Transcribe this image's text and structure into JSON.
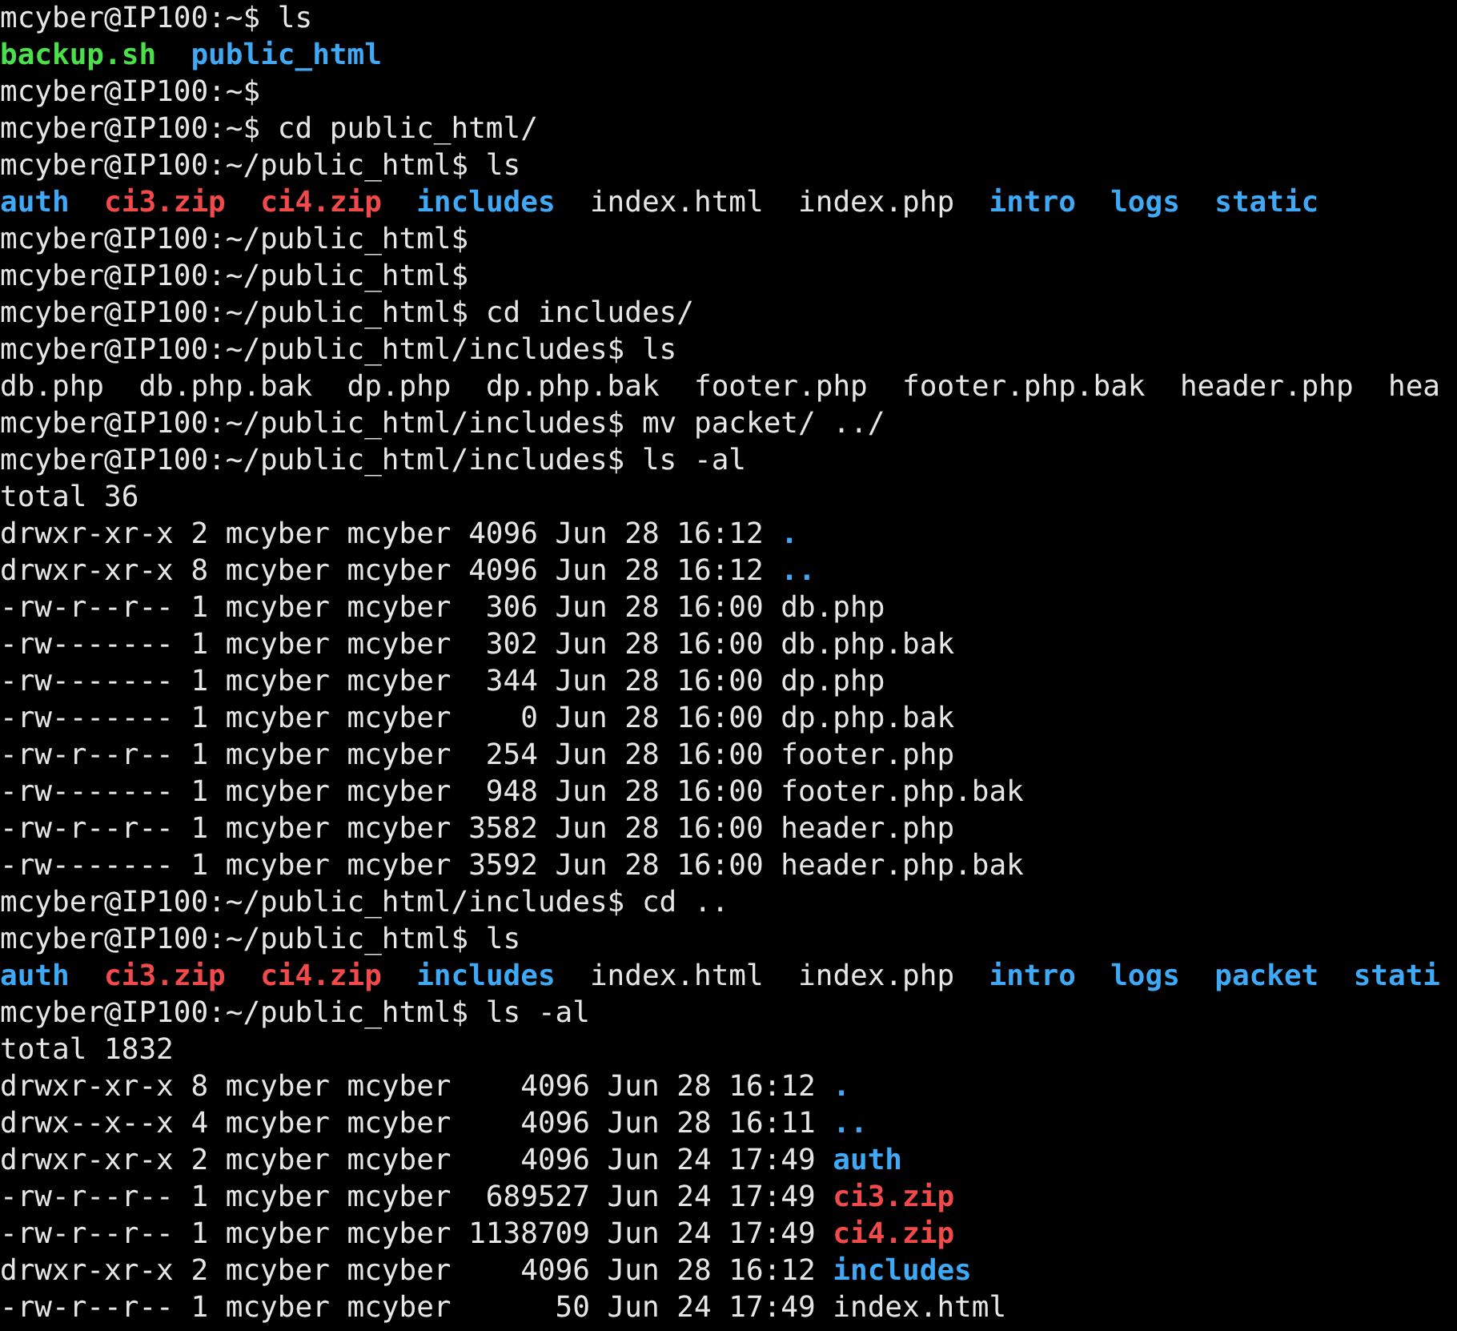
{
  "terminal": {
    "lines": [
      {
        "kind": "text",
        "segments": [
          {
            "text": "mcyber@IP100:~$ ls",
            "kind": "plain"
          }
        ]
      },
      {
        "kind": "listing",
        "segments": [
          {
            "text": "backup.sh",
            "kind": "exec"
          },
          {
            "text": "public_html",
            "kind": "dir"
          }
        ]
      },
      {
        "kind": "text",
        "segments": [
          {
            "text": "mcyber@IP100:~$",
            "kind": "plain"
          }
        ]
      },
      {
        "kind": "text",
        "segments": [
          {
            "text": "mcyber@IP100:~$ cd public_html/",
            "kind": "plain"
          }
        ]
      },
      {
        "kind": "text",
        "segments": [
          {
            "text": "mcyber@IP100:~/public_html$ ls",
            "kind": "plain"
          }
        ]
      },
      {
        "kind": "listing",
        "segments": [
          {
            "text": "auth",
            "kind": "dir"
          },
          {
            "text": "ci3.zip",
            "kind": "archive"
          },
          {
            "text": "ci4.zip",
            "kind": "archive"
          },
          {
            "text": "includes",
            "kind": "dir"
          },
          {
            "text": "index.html",
            "kind": "plain"
          },
          {
            "text": "index.php",
            "kind": "plain"
          },
          {
            "text": "intro",
            "kind": "dir"
          },
          {
            "text": "logs",
            "kind": "dir"
          },
          {
            "text": "static",
            "kind": "dir"
          }
        ]
      },
      {
        "kind": "text",
        "segments": [
          {
            "text": "mcyber@IP100:~/public_html$",
            "kind": "plain"
          }
        ]
      },
      {
        "kind": "text",
        "segments": [
          {
            "text": "mcyber@IP100:~/public_html$",
            "kind": "plain"
          }
        ]
      },
      {
        "kind": "text",
        "segments": [
          {
            "text": "mcyber@IP100:~/public_html$ cd includes/",
            "kind": "plain"
          }
        ]
      },
      {
        "kind": "text",
        "segments": [
          {
            "text": "mcyber@IP100:~/public_html/includes$ ls",
            "kind": "plain"
          }
        ]
      },
      {
        "kind": "listing",
        "segments": [
          {
            "text": "db.php",
            "kind": "plain"
          },
          {
            "text": "db.php.bak",
            "kind": "plain"
          },
          {
            "text": "dp.php",
            "kind": "plain"
          },
          {
            "text": "dp.php.bak",
            "kind": "plain"
          },
          {
            "text": "footer.php",
            "kind": "plain"
          },
          {
            "text": "footer.php.bak",
            "kind": "plain"
          },
          {
            "text": "header.php",
            "kind": "plain"
          },
          {
            "text": "hea",
            "kind": "plain"
          }
        ]
      },
      {
        "kind": "text",
        "segments": [
          {
            "text": "mcyber@IP100:~/public_html/includes$ mv packet/ ../",
            "kind": "plain"
          }
        ]
      },
      {
        "kind": "text",
        "segments": [
          {
            "text": "mcyber@IP100:~/public_html/includes$ ls -al",
            "kind": "plain"
          }
        ]
      },
      {
        "kind": "text",
        "segments": [
          {
            "text": "total 36",
            "kind": "plain"
          }
        ]
      },
      {
        "kind": "detail",
        "segments": [
          {
            "text": "drwxr-xr-x 2 mcyber mcyber 4096 Jun 28 16:12",
            "kind": "plain"
          },
          {
            "text": ".",
            "kind": "dir"
          }
        ]
      },
      {
        "kind": "detail",
        "segments": [
          {
            "text": "drwxr-xr-x 8 mcyber mcyber 4096 Jun 28 16:12",
            "kind": "plain"
          },
          {
            "text": "..",
            "kind": "dir"
          }
        ]
      },
      {
        "kind": "detail",
        "segments": [
          {
            "text": "-rw-r--r-- 1 mcyber mcyber  306 Jun 28 16:00",
            "kind": "plain"
          },
          {
            "text": "db.php",
            "kind": "plain"
          }
        ]
      },
      {
        "kind": "detail",
        "segments": [
          {
            "text": "-rw------- 1 mcyber mcyber  302 Jun 28 16:00",
            "kind": "plain"
          },
          {
            "text": "db.php.bak",
            "kind": "plain"
          }
        ]
      },
      {
        "kind": "detail",
        "segments": [
          {
            "text": "-rw------- 1 mcyber mcyber  344 Jun 28 16:00",
            "kind": "plain"
          },
          {
            "text": "dp.php",
            "kind": "plain"
          }
        ]
      },
      {
        "kind": "detail",
        "segments": [
          {
            "text": "-rw------- 1 mcyber mcyber    0 Jun 28 16:00",
            "kind": "plain"
          },
          {
            "text": "dp.php.bak",
            "kind": "plain"
          }
        ]
      },
      {
        "kind": "detail",
        "segments": [
          {
            "text": "-rw-r--r-- 1 mcyber mcyber  254 Jun 28 16:00",
            "kind": "plain"
          },
          {
            "text": "footer.php",
            "kind": "plain"
          }
        ]
      },
      {
        "kind": "detail",
        "segments": [
          {
            "text": "-rw------- 1 mcyber mcyber  948 Jun 28 16:00",
            "kind": "plain"
          },
          {
            "text": "footer.php.bak",
            "kind": "plain"
          }
        ]
      },
      {
        "kind": "detail",
        "segments": [
          {
            "text": "-rw-r--r-- 1 mcyber mcyber 3582 Jun 28 16:00",
            "kind": "plain"
          },
          {
            "text": "header.php",
            "kind": "plain"
          }
        ]
      },
      {
        "kind": "detail",
        "segments": [
          {
            "text": "-rw------- 1 mcyber mcyber 3592 Jun 28 16:00",
            "kind": "plain"
          },
          {
            "text": "header.php.bak",
            "kind": "plain"
          }
        ]
      },
      {
        "kind": "text",
        "segments": [
          {
            "text": "mcyber@IP100:~/public_html/includes$ cd ..",
            "kind": "plain"
          }
        ]
      },
      {
        "kind": "text",
        "segments": [
          {
            "text": "mcyber@IP100:~/public_html$ ls",
            "kind": "plain"
          }
        ]
      },
      {
        "kind": "listing",
        "segments": [
          {
            "text": "auth",
            "kind": "dir"
          },
          {
            "text": "ci3.zip",
            "kind": "archive"
          },
          {
            "text": "ci4.zip",
            "kind": "archive"
          },
          {
            "text": "includes",
            "kind": "dir"
          },
          {
            "text": "index.html",
            "kind": "plain"
          },
          {
            "text": "index.php",
            "kind": "plain"
          },
          {
            "text": "intro",
            "kind": "dir"
          },
          {
            "text": "logs",
            "kind": "dir"
          },
          {
            "text": "packet",
            "kind": "dir"
          },
          {
            "text": "stati",
            "kind": "dir"
          }
        ]
      },
      {
        "kind": "text",
        "segments": [
          {
            "text": "mcyber@IP100:~/public_html$ ls -al",
            "kind": "plain"
          }
        ]
      },
      {
        "kind": "text",
        "segments": [
          {
            "text": "total 1832",
            "kind": "plain"
          }
        ]
      },
      {
        "kind": "detail",
        "segments": [
          {
            "text": "drwxr-xr-x 8 mcyber mcyber    4096 Jun 28 16:12",
            "kind": "plain"
          },
          {
            "text": ".",
            "kind": "dir"
          }
        ]
      },
      {
        "kind": "detail",
        "segments": [
          {
            "text": "drwx--x--x 4 mcyber mcyber    4096 Jun 28 16:11",
            "kind": "plain"
          },
          {
            "text": "..",
            "kind": "dir"
          }
        ]
      },
      {
        "kind": "detail",
        "segments": [
          {
            "text": "drwxr-xr-x 2 mcyber mcyber    4096 Jun 24 17:49",
            "kind": "plain"
          },
          {
            "text": "auth",
            "kind": "dir"
          }
        ]
      },
      {
        "kind": "detail",
        "segments": [
          {
            "text": "-rw-r--r-- 1 mcyber mcyber  689527 Jun 24 17:49",
            "kind": "plain"
          },
          {
            "text": "ci3.zip",
            "kind": "archive"
          }
        ]
      },
      {
        "kind": "detail",
        "segments": [
          {
            "text": "-rw-r--r-- 1 mcyber mcyber 1138709 Jun 24 17:49",
            "kind": "plain"
          },
          {
            "text": "ci4.zip",
            "kind": "archive"
          }
        ]
      },
      {
        "kind": "detail",
        "segments": [
          {
            "text": "drwxr-xr-x 2 mcyber mcyber    4096 Jun 28 16:12",
            "kind": "plain"
          },
          {
            "text": "includes",
            "kind": "dir"
          }
        ]
      },
      {
        "kind": "detail",
        "segments": [
          {
            "text": "-rw-r--r-- 1 mcyber mcyber      50 Jun 24 17:49",
            "kind": "plain"
          },
          {
            "text": "index.html",
            "kind": "plain"
          }
        ]
      }
    ]
  }
}
